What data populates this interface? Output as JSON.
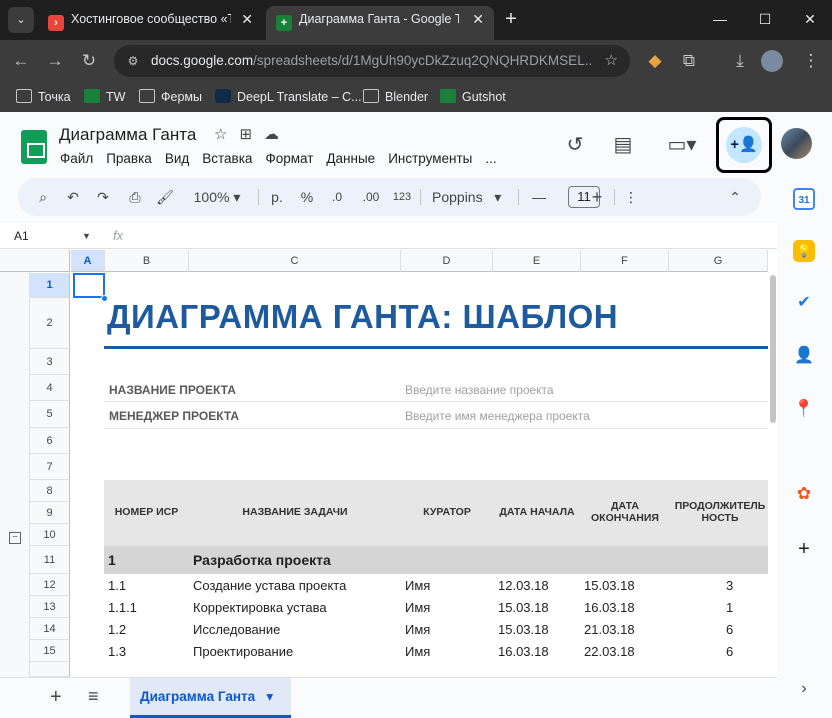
{
  "browser": {
    "tabs": [
      {
        "title": "Хостинговое сообщество «Tim",
        "close": "✕"
      },
      {
        "title": "Диаграмма Ганта - Google Таб",
        "close": "✕"
      }
    ],
    "new_tab": "+",
    "url_host": "docs.google.com",
    "url_path": "/spreadsheets/d/1MgUh90ycDkZzuq2QNQHRDKMSEL...",
    "bookmarks": [
      "Точка",
      "TW",
      "Фермы",
      "DeepL Translate – C...",
      "Blender",
      "Gutshot"
    ]
  },
  "doc": {
    "title": "Диаграмма Ганта",
    "menu": [
      "Файл",
      "Правка",
      "Вид",
      "Вставка",
      "Формат",
      "Данные",
      "Инструменты",
      "..."
    ]
  },
  "toolbar": {
    "zoom": "100%",
    "currency": "р.",
    "percent": "%",
    "dec_less": ".0",
    "dec_more": ".00",
    "number_format": "123",
    "font": "Poppins",
    "font_size": "11"
  },
  "formula": {
    "cell_ref": "A1",
    "fx": "fx"
  },
  "sheet": {
    "columns": [
      "A",
      "B",
      "C",
      "D",
      "E",
      "F",
      "G"
    ],
    "rows": [
      "1",
      "2",
      "3",
      "4",
      "5",
      "6",
      "7",
      "8",
      "9",
      "10",
      "11",
      "12",
      "13",
      "14",
      "15"
    ],
    "title": "ДИАГРАММА ГАНТА: ШАБЛОН",
    "project_name_label": "НАЗВАНИЕ ПРОЕКТА",
    "project_name_value": "Введите название проекта",
    "manager_label": "МЕНЕДЖЕР ПРОЕКТА",
    "manager_value": "Введите имя менеджера проекта",
    "headers": {
      "wbs": "НОМЕР ИСР",
      "task": "НАЗВАНИЕ ЗАДАЧИ",
      "owner": "КУРАТОР",
      "start": "ДАТА НАЧАЛА",
      "end": "ДАТА ОКОНЧАНИЯ",
      "duration": "ПРОДОЛЖИТЕЛЬНОСТЬ"
    },
    "phase": {
      "num": "1",
      "name": "Разработка проекта"
    },
    "tasks": [
      {
        "wbs": "1.1",
        "name": "Создание устава проекта",
        "owner": "Имя",
        "start": "12.03.18",
        "end": "15.03.18",
        "dur": "3"
      },
      {
        "wbs": "1.1.1",
        "name": "Корректировка устава",
        "owner": "Имя",
        "start": "15.03.18",
        "end": "16.03.18",
        "dur": "1"
      },
      {
        "wbs": "1.2",
        "name": "Исследование",
        "owner": "Имя",
        "start": "15.03.18",
        "end": "21.03.18",
        "dur": "6"
      },
      {
        "wbs": "1.3",
        "name": "Проектирование",
        "owner": "Имя",
        "start": "16.03.18",
        "end": "22.03.18",
        "dur": "6"
      }
    ],
    "active_sheet": "Диаграмма Ганта"
  }
}
